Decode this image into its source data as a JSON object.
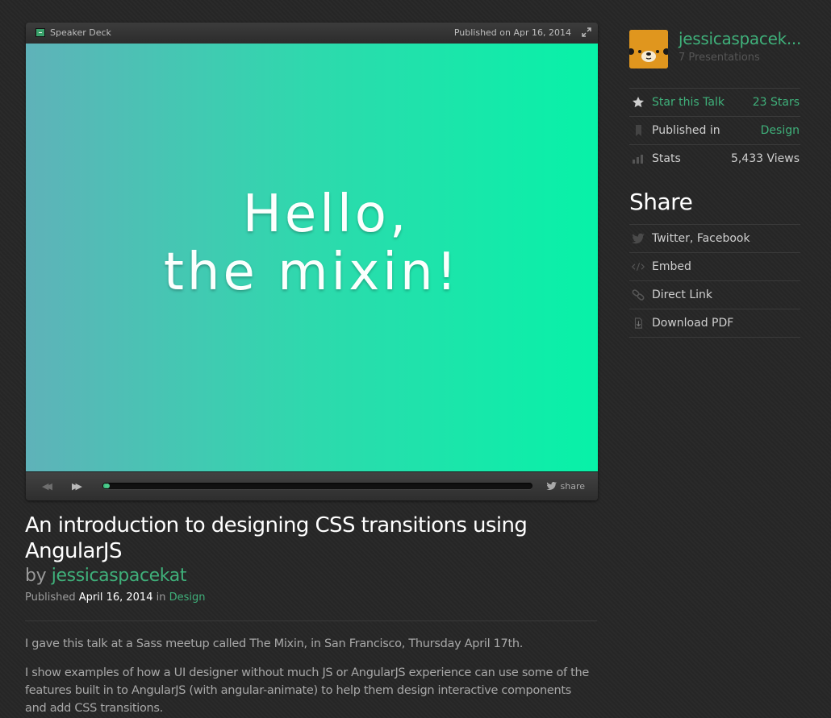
{
  "player": {
    "brand": "Speaker Deck",
    "published": "Published on Apr 16, 2014",
    "slide_line1": "Hello,",
    "slide_line2": "the mixin!",
    "share_label": "share",
    "progress": 0.01
  },
  "talk": {
    "title": "An introduction to designing CSS transitions using AngularJS",
    "by_prefix": "by",
    "author": "jessicaspacekat",
    "published_label": "Published",
    "published_date": "April 16, 2014",
    "in_label": "in",
    "category": "Design",
    "description": [
      "I gave this talk at a Sass meetup called The Mixin, in San Francisco, Thursday April 17th.",
      "I show examples of how a UI designer without much JS or AngularJS experience can use some of the features built in to AngularJS (with angular-animate) to help them design interactive components and add CSS transitions."
    ]
  },
  "sidebar": {
    "author_name": "jessicaspacek...",
    "presentations": "7 Presentations",
    "star_label": "Star this Talk",
    "star_value": "23 Stars",
    "published_in_label": "Published in",
    "published_in_value": "Design",
    "stats_label": "Stats",
    "stats_value": "5,433 Views",
    "share_heading": "Share",
    "share_items": [
      {
        "label": "Twitter, Facebook",
        "icon": "twitter-bird-icon"
      },
      {
        "label": "Embed",
        "icon": "code-brackets-icon"
      },
      {
        "label": "Direct Link",
        "icon": "chain-link-icon"
      },
      {
        "label": "Download PDF",
        "icon": "download-icon"
      }
    ]
  },
  "colors": {
    "accent": "#3fb07a",
    "background": "#272727",
    "slide_gradient_start": "#5fb2b9",
    "slide_gradient_end": "#07f2a8",
    "avatar": "#e0961e"
  }
}
